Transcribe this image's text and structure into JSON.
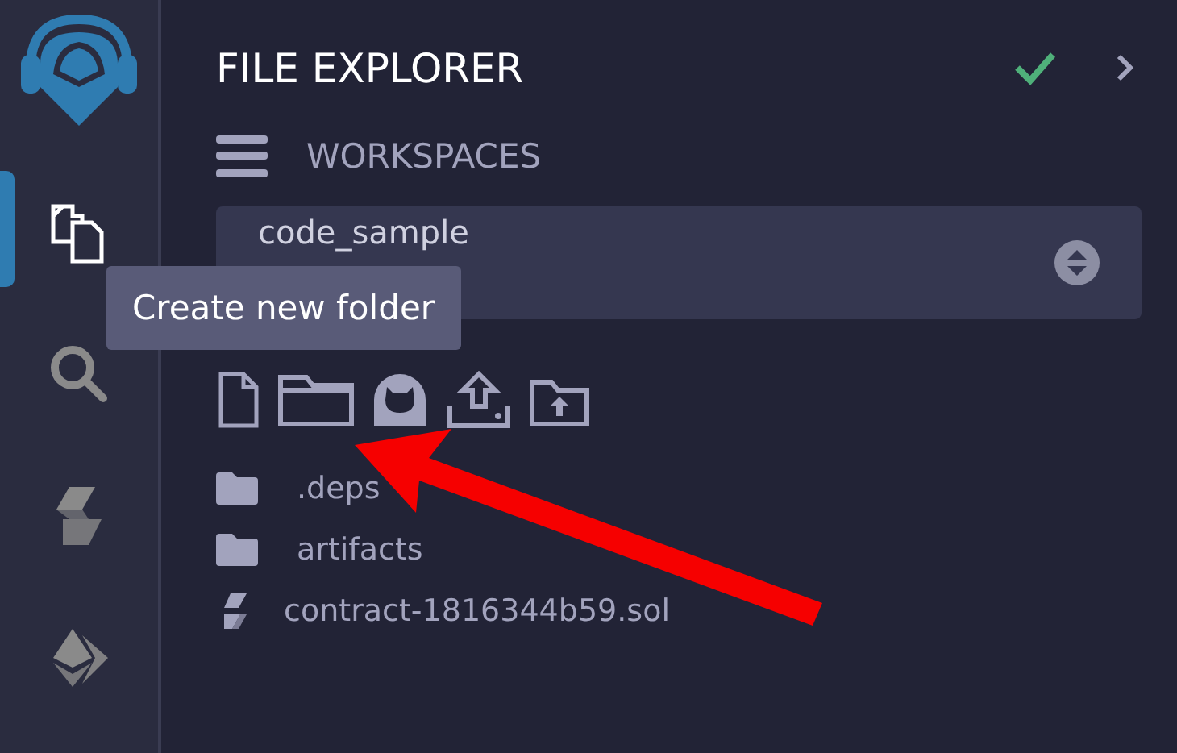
{
  "sidebar": {
    "items": [
      {
        "kind": "files",
        "selected": true
      },
      {
        "kind": "search",
        "selected": false
      },
      {
        "kind": "solidity",
        "selected": false
      },
      {
        "kind": "deploy",
        "selected": false
      }
    ]
  },
  "panel": {
    "title": "FILE EXPLORER",
    "section": "WORKSPACES",
    "workspace": "code_sample"
  },
  "toolbar": [
    {
      "kind": "new-file"
    },
    {
      "kind": "new-folder"
    },
    {
      "kind": "github"
    },
    {
      "kind": "upload"
    },
    {
      "kind": "upload-folder"
    }
  ],
  "tooltip": "Create new folder",
  "files": [
    {
      "kind": "folder",
      "name": ".deps"
    },
    {
      "kind": "folder",
      "name": "artifacts"
    },
    {
      "kind": "solidity",
      "name": "contract-1816344b59.sol"
    }
  ]
}
